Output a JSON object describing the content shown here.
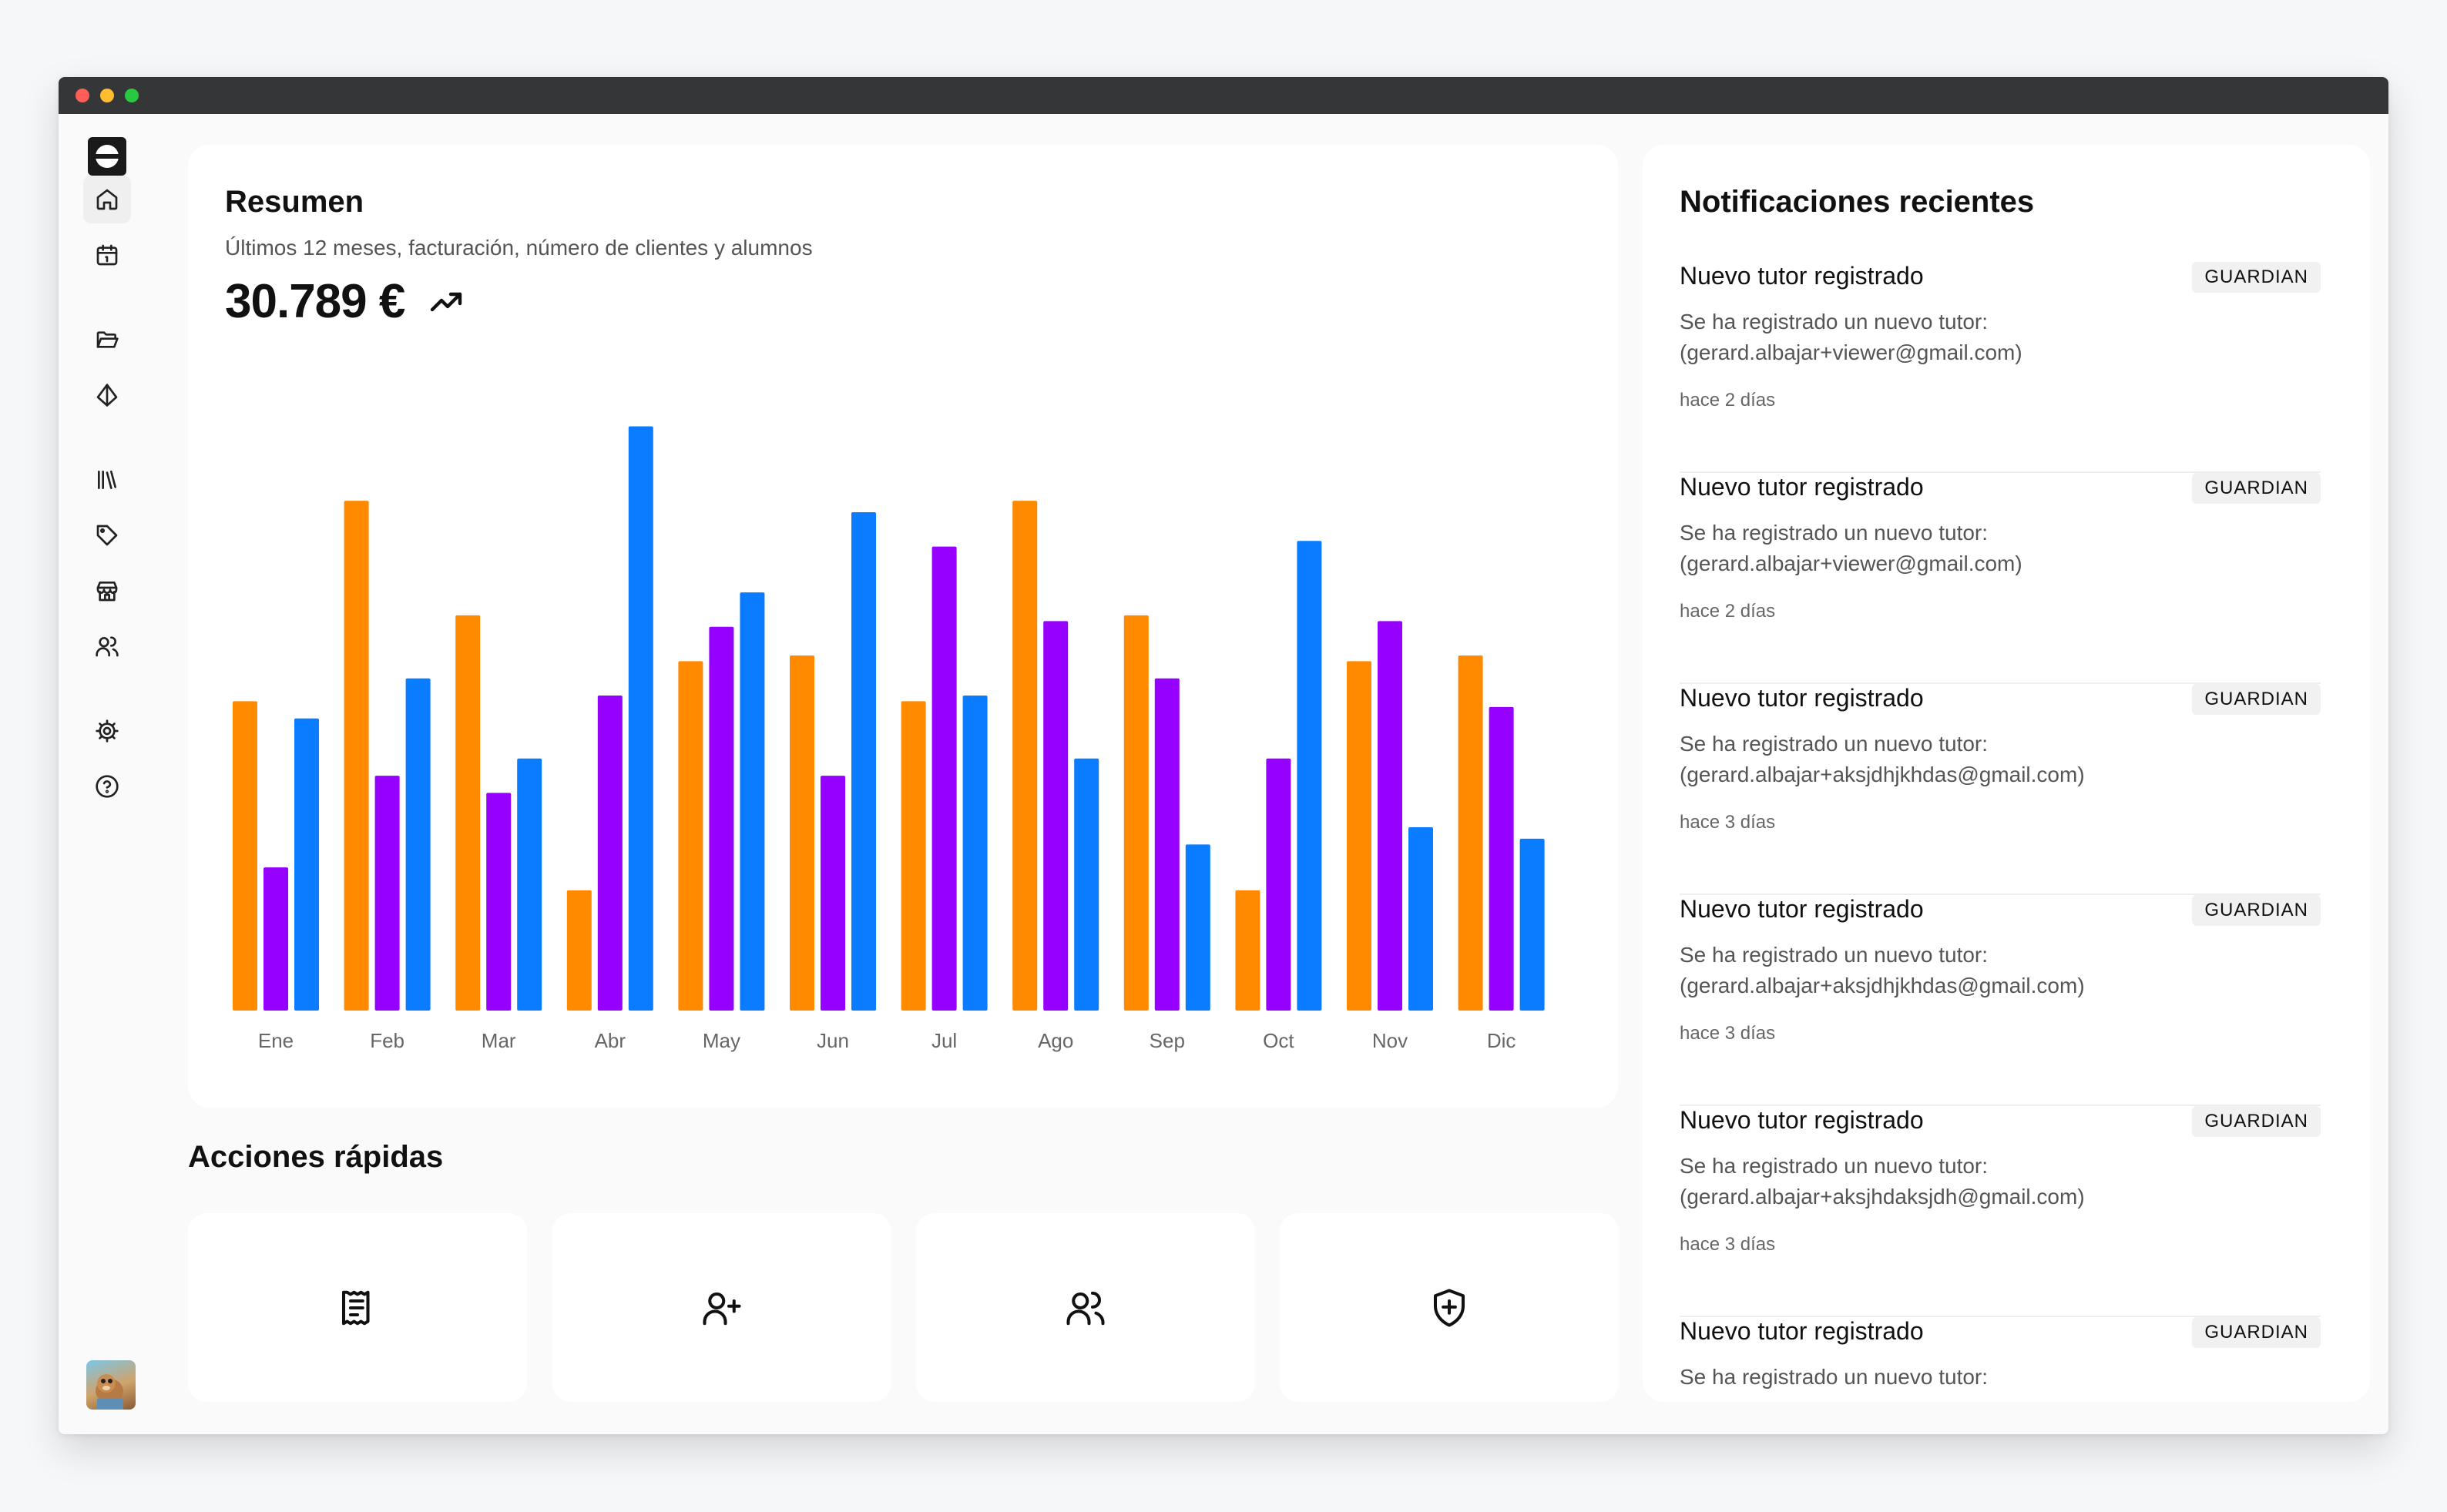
{
  "window": {
    "traffic_lights": [
      "#ff5f57",
      "#febc2e",
      "#28c840"
    ]
  },
  "sidebar": {
    "logo_icon": "logo-icon",
    "items": [
      {
        "name": "home",
        "icon": "home-icon",
        "active": true
      },
      {
        "name": "calendar",
        "icon": "calendar-icon"
      },
      {
        "name": "folder",
        "icon": "folder-open-icon"
      },
      {
        "name": "shapes",
        "icon": "pyramid-icon"
      },
      {
        "name": "library",
        "icon": "library-icon"
      },
      {
        "name": "tags",
        "icon": "tag-icon"
      },
      {
        "name": "store",
        "icon": "store-icon"
      },
      {
        "name": "users",
        "icon": "users-icon"
      },
      {
        "name": "settings",
        "icon": "gear-icon"
      },
      {
        "name": "help",
        "icon": "help-circle-icon"
      }
    ],
    "avatar_icon": "user-avatar"
  },
  "summary": {
    "title": "Resumen",
    "subtitle": "Últimos 12 meses, facturación, número de clientes y alumnos",
    "total": "30.789 €",
    "trend_icon": "trending-up-icon"
  },
  "chart_data": {
    "type": "bar",
    "categories": [
      "Ene",
      "Feb",
      "Mar",
      "Abr",
      "May",
      "Jun",
      "Jul",
      "Ago",
      "Sep",
      "Oct",
      "Nov",
      "Dic"
    ],
    "series": [
      {
        "color": "#ff8a00",
        "values": [
          54,
          89,
          69,
          21,
          61,
          62,
          54,
          89,
          69,
          21,
          61,
          62
        ]
      },
      {
        "color": "#9500ff",
        "values": [
          25,
          41,
          38,
          55,
          67,
          41,
          81,
          68,
          58,
          44,
          68,
          53
        ]
      },
      {
        "color": "#0a7cff",
        "values": [
          51,
          58,
          44,
          102,
          73,
          87,
          55,
          44,
          29,
          82,
          32,
          30
        ]
      }
    ],
    "ylim": [
      0,
      110
    ],
    "grid": false,
    "legend": "none"
  },
  "quick_actions": {
    "title": "Acciones rápidas",
    "items": [
      {
        "icon": "receipt-icon"
      },
      {
        "icon": "user-plus-icon"
      },
      {
        "icon": "users-icon"
      },
      {
        "icon": "shield-plus-icon"
      }
    ]
  },
  "notifications": {
    "title": "Notificaciones recientes",
    "items": [
      {
        "title": "Nuevo tutor registrado",
        "badge": "GUARDIAN",
        "line1": "Se ha registrado un nuevo tutor:",
        "line2": "(gerard.albajar+viewer@gmail.com)",
        "time": "hace 2 días"
      },
      {
        "title": "Nuevo tutor registrado",
        "badge": "GUARDIAN",
        "line1": "Se ha registrado un nuevo tutor:",
        "line2": "(gerard.albajar+viewer@gmail.com)",
        "time": "hace 2 días"
      },
      {
        "title": "Nuevo tutor registrado",
        "badge": "GUARDIAN",
        "line1": "Se ha registrado un nuevo tutor:",
        "line2": "(gerard.albajar+aksjdhjkhdas@gmail.com)",
        "time": "hace 3 días"
      },
      {
        "title": "Nuevo tutor registrado",
        "badge": "GUARDIAN",
        "line1": "Se ha registrado un nuevo tutor:",
        "line2": "(gerard.albajar+aksjdhjkhdas@gmail.com)",
        "time": "hace 3 días"
      },
      {
        "title": "Nuevo tutor registrado",
        "badge": "GUARDIAN",
        "line1": "Se ha registrado un nuevo tutor:",
        "line2": "(gerard.albajar+aksjhdaksjdh@gmail.com)",
        "time": "hace 3 días"
      },
      {
        "title": "Nuevo tutor registrado",
        "badge": "GUARDIAN",
        "line1": "Se ha registrado un nuevo tutor:",
        "line2": "",
        "time": ""
      }
    ]
  }
}
